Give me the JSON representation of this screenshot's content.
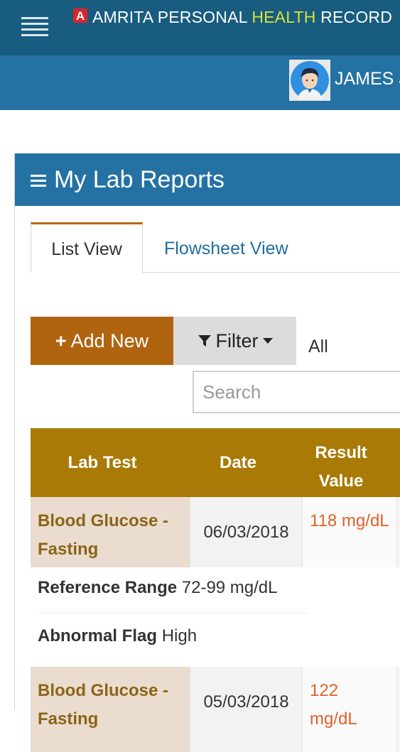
{
  "app": {
    "logo_letter": "A",
    "title_part1": "AMRITA PERSONAL ",
    "title_highlight": "HEALTH",
    "title_part2": " RECORD",
    "user_name": "JAMES J"
  },
  "panel": {
    "title": "My Lab Reports",
    "tabs": [
      {
        "label": "List View",
        "active": true
      },
      {
        "label": "Flowsheet View",
        "active": false
      }
    ]
  },
  "toolbar": {
    "add_label": "Add New",
    "filter_label": "Filter",
    "filter_value": "All",
    "search_placeholder": "Search"
  },
  "table": {
    "columns": [
      "Lab Test",
      "Date",
      "Result Value"
    ],
    "rows": [
      {
        "lab_test": "Blood Glucose - Fasting",
        "date": "06/03/2018",
        "result": "118 mg/dL",
        "reference_label": "Reference Range",
        "reference_value": "72-99 mg/dL",
        "flag_label": "Abnormal Flag",
        "flag_value": "High"
      },
      {
        "lab_test": "Blood Glucose - Fasting",
        "date": "05/03/2018",
        "result": "122 mg/dL"
      }
    ]
  },
  "colors": {
    "topbar": "#185c80",
    "userbar": "#2472a4",
    "accent_orange": "#b0640f",
    "table_header": "#a97a06",
    "result_text": "#e0622a",
    "title_highlight": "#d6e43a"
  },
  "icons": [
    "hamburger-menu-icon",
    "app-logo-icon",
    "user-avatar-icon",
    "list-menu-icon",
    "plus-icon",
    "filter-funnel-icon",
    "caret-down-icon"
  ]
}
